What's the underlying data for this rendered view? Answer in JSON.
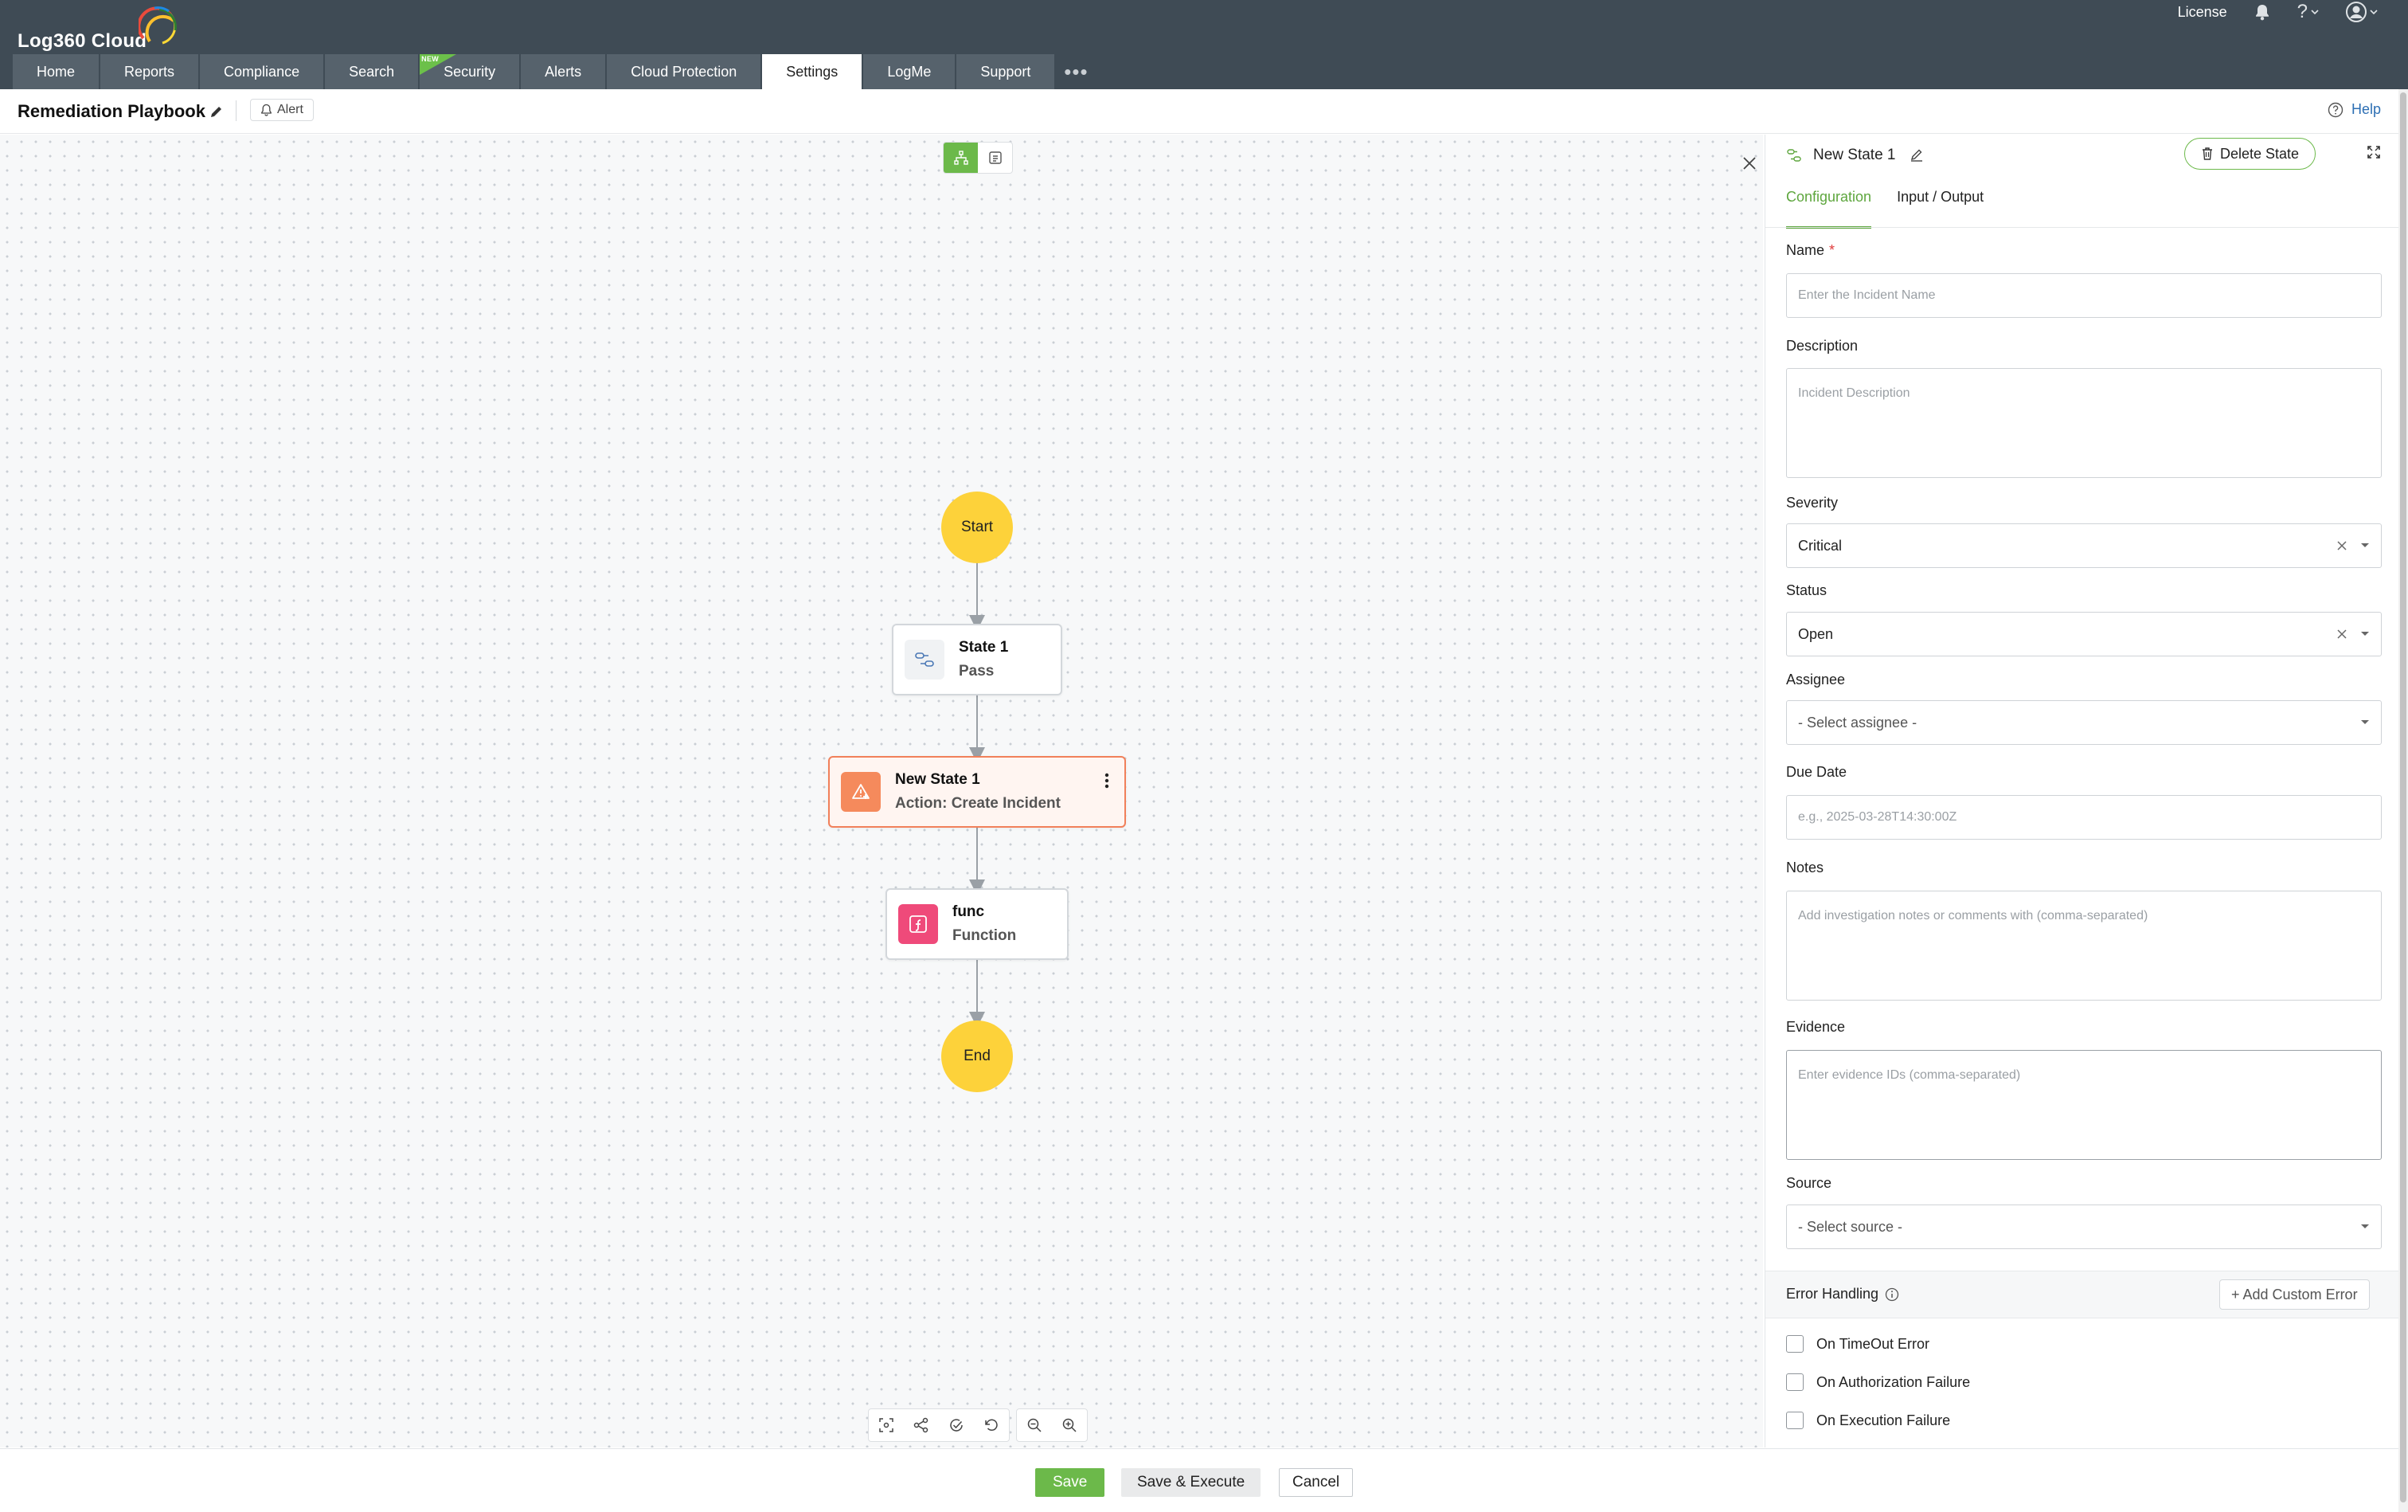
{
  "header": {
    "logo_text": "Log360 Cloud",
    "license_label": "License",
    "help_glyph": "?",
    "nav": [
      {
        "label": "Home"
      },
      {
        "label": "Reports"
      },
      {
        "label": "Compliance"
      },
      {
        "label": "Search"
      },
      {
        "label": "Security",
        "badge": "NEW"
      },
      {
        "label": "Alerts"
      },
      {
        "label": "Cloud Protection"
      },
      {
        "label": "Settings",
        "active": true
      },
      {
        "label": "LogMe"
      },
      {
        "label": "Support"
      }
    ],
    "more_label": "•••"
  },
  "subheader": {
    "title": "Remediation Playbook",
    "alert_chip": "Alert",
    "help_label": "Help"
  },
  "canvas": {
    "start_label": "Start",
    "end_label": "End",
    "nodes": [
      {
        "name": "State 1",
        "type": "Pass"
      },
      {
        "name": "New State 1",
        "type": "Action: Create Incident"
      },
      {
        "name": "func",
        "type": "Function"
      }
    ]
  },
  "panel": {
    "title": "New State 1",
    "delete_label": "Delete State",
    "tabs": [
      {
        "label": "Configuration",
        "active": true
      },
      {
        "label": "Input / Output"
      }
    ],
    "fields": {
      "name": {
        "label": "Name",
        "required_mark": "*",
        "placeholder": "Enter the Incident Name",
        "value": ""
      },
      "description": {
        "label": "Description",
        "placeholder": "Incident Description",
        "value": ""
      },
      "severity": {
        "label": "Severity",
        "value": "Critical"
      },
      "status": {
        "label": "Status",
        "value": "Open"
      },
      "assignee": {
        "label": "Assignee",
        "value": "- Select assignee -"
      },
      "due_date": {
        "label": "Due Date",
        "placeholder": "e.g., 2025-03-28T14:30:00Z",
        "value": ""
      },
      "notes": {
        "label": "Notes",
        "placeholder": "Add investigation notes or comments with (comma-separated)",
        "value": ""
      },
      "evidence": {
        "label": "Evidence",
        "placeholder": "Enter evidence IDs (comma-separated)",
        "value": ""
      },
      "source": {
        "label": "Source",
        "value": "- Select source -"
      }
    },
    "error_handling": {
      "title": "Error Handling",
      "add_label": "+ Add Custom Error",
      "options": [
        {
          "label": "On TimeOut Error",
          "checked": false
        },
        {
          "label": "On Authorization Failure",
          "checked": false
        },
        {
          "label": "On Execution Failure",
          "checked": false
        }
      ]
    }
  },
  "footer": {
    "save_label": "Save",
    "save_execute_label": "Save & Execute",
    "cancel_label": "Cancel"
  },
  "colors": {
    "header_bg": "#3f4b55",
    "nav_tab_bg": "#56626c",
    "accent_green": "#6cb94a",
    "terminal_yellow": "#fdd23a",
    "selected_node_border": "#f1805a",
    "function_icon_pink": "#ef4a7a",
    "action_icon_orange": "#f58a5c",
    "link_blue": "#2d6fb4"
  }
}
